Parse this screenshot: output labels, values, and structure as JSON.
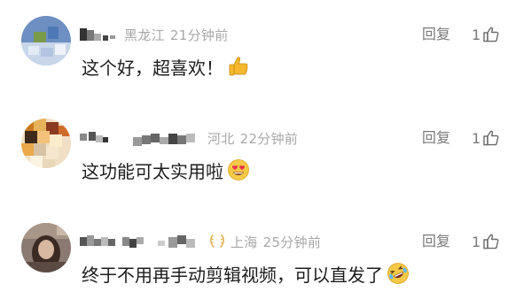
{
  "comments": [
    {
      "region": "黑龙江",
      "time": "21分钟前",
      "text": "这个好，超喜欢！",
      "emoji": "thumbs-up",
      "reply_label": "回复",
      "like_count": "1"
    },
    {
      "region": "河北",
      "time": "22分钟前",
      "text": "这功能可太实用啦",
      "emoji": "heart-eyes",
      "reply_label": "回复",
      "like_count": "1"
    },
    {
      "region": "上海",
      "time": "25分钟前",
      "text": "终于不用再手动剪辑视频，可以直发了",
      "emoji": "rofl",
      "reply_label": "回复",
      "like_count": "1"
    }
  ],
  "icons": {
    "like": "thumb-up-outline-icon",
    "badge": "laurel-badge-icon"
  },
  "colors": {
    "meta": "#a8a8a8",
    "body": "#1d1d1d",
    "action": "#7a7a7a"
  }
}
